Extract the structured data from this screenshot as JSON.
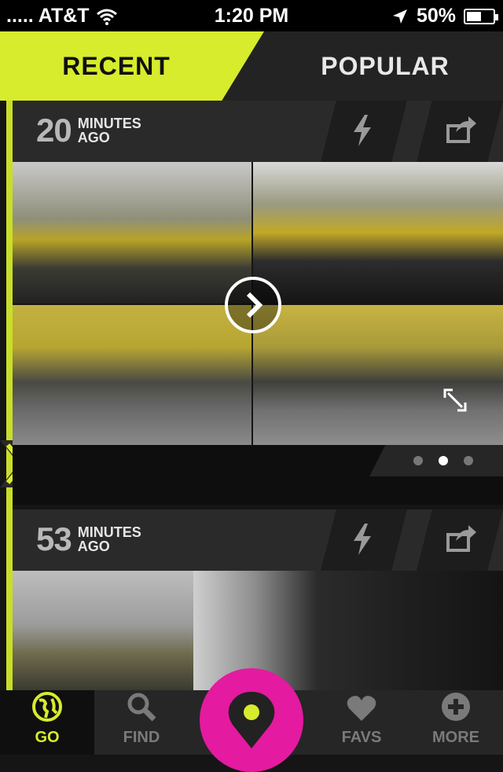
{
  "status": {
    "carrier": ".....  AT&T",
    "time": "1:20 PM",
    "battery": "50%",
    "battery_level": 0.5
  },
  "tabs": [
    {
      "label": "RECENT",
      "active": true
    },
    {
      "label": "POPULAR",
      "active": false
    }
  ],
  "colors": {
    "accent": "#d7ec2c",
    "center_button": "#e41aa0"
  },
  "feed": [
    {
      "number": "20",
      "unit_line1": "MINUTES",
      "unit_line2": "AGO",
      "actions": [
        "lightning-icon",
        "share-icon"
      ],
      "page_count": 3,
      "current_page": 2
    },
    {
      "number": "53",
      "unit_line1": "MINUTES",
      "unit_line2": "AGO",
      "actions": [
        "lightning-icon",
        "share-icon"
      ]
    }
  ],
  "nav": [
    {
      "label": "GO",
      "icon": "globe-icon",
      "active": true
    },
    {
      "label": "FIND",
      "icon": "search-icon",
      "active": false
    },
    {
      "label": "",
      "icon": "location-pin-icon",
      "active": false
    },
    {
      "label": "FAVS",
      "icon": "heart-icon",
      "active": false
    },
    {
      "label": "MORE",
      "icon": "plus-icon",
      "active": false
    }
  ]
}
